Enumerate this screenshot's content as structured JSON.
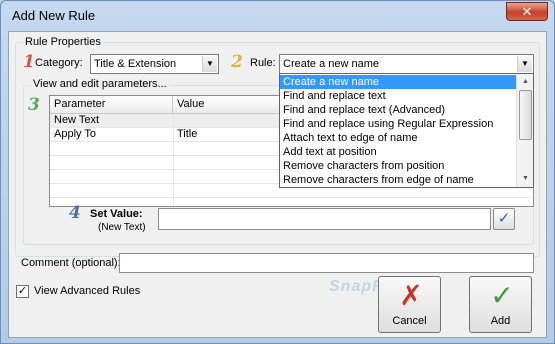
{
  "window": {
    "title": "Add New Rule",
    "close_glyph": "✕"
  },
  "rule_properties": {
    "legend": "Rule Properties",
    "step1": "1",
    "category_label": "Category:",
    "category_value": "Title & Extension",
    "step2": "2",
    "rule_label": "Rule:",
    "rule_value": "Create a new name"
  },
  "rule_dropdown": {
    "items": [
      "Create a new name",
      "Find and replace text",
      "Find and replace text (Advanced)",
      "Find and replace using Regular Expression",
      "Attach text to edge of name",
      "Add text at position",
      "Remove characters from position",
      "Remove characters from edge of name"
    ],
    "selected_index": 0
  },
  "parameters": {
    "legend": "View and edit parameters...",
    "step3": "3",
    "columns": [
      "Parameter",
      "Value"
    ],
    "rows": [
      {
        "parameter": "New Text",
        "value": ""
      },
      {
        "parameter": "Apply To",
        "value": "Title"
      }
    ]
  },
  "set_value": {
    "step4": "4",
    "label": "Set Value:",
    "sublabel": "(New Text)",
    "value": "",
    "confirm_glyph": "✓"
  },
  "comment": {
    "label": "Comment (optional):",
    "value": ""
  },
  "view_advanced": {
    "label": "View Advanced Rules",
    "checked": true,
    "check_glyph": "✓"
  },
  "buttons": {
    "cancel_label": "Cancel",
    "cancel_glyph": "✗",
    "add_label": "Add",
    "add_glyph": "✓"
  },
  "watermark": "SnapFiles",
  "icons": {
    "close": "close-icon",
    "dropdown_arrow": "chevron-down-icon",
    "confirm": "check-icon",
    "cancel": "cross-icon",
    "add": "check-icon"
  },
  "colors": {
    "selection": "#3399ff",
    "step1": "#c75b4a",
    "step2": "#d9b43a",
    "step3": "#5aa95a",
    "step4": "#4d6f9c"
  }
}
